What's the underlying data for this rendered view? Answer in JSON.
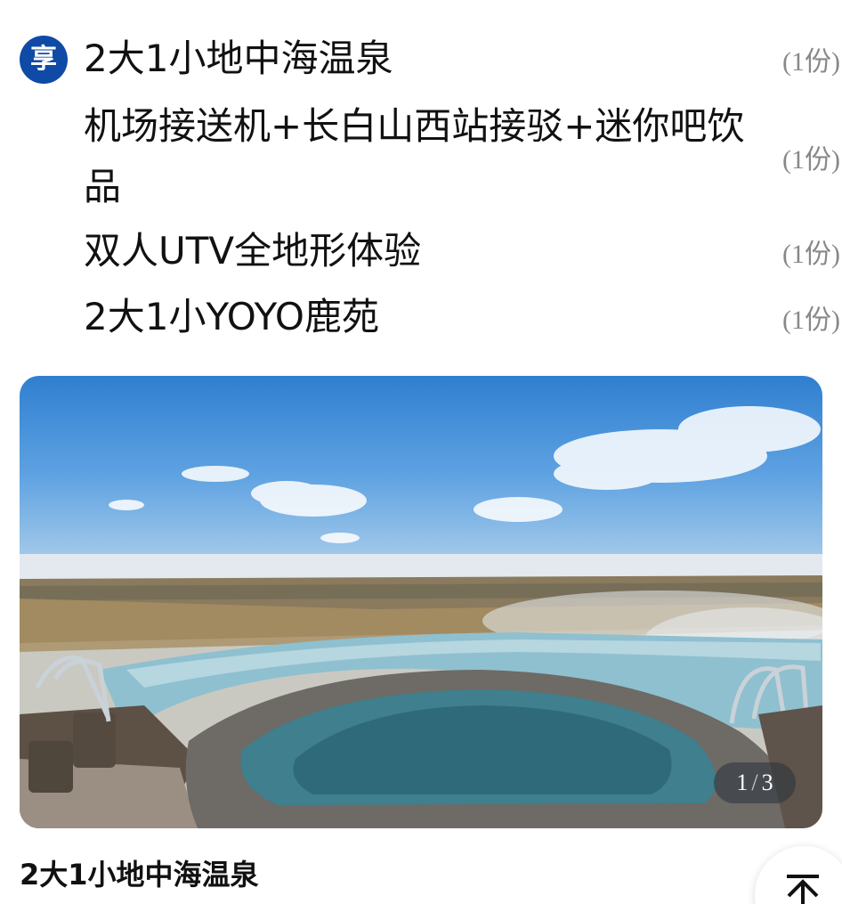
{
  "package": {
    "badge": "享",
    "items": [
      {
        "name": "2大1小地中海温泉",
        "qty": "(1份)"
      },
      {
        "name": "机场接送机+长白山西站接驳+迷你吧饮品",
        "qty": "(1份)"
      },
      {
        "name": "双人UTV全地形体验",
        "qty": "(1份)"
      },
      {
        "name": "2大1小YOYO鹿苑",
        "qty": "(1份)"
      }
    ]
  },
  "gallery": {
    "counter_current": "1",
    "counter_separator": "/",
    "counter_total": "3",
    "caption": "2大1小地中海温泉"
  },
  "icons": {
    "back_to_top": "arrow-up-icon"
  },
  "colors": {
    "badge": "#0f4aa6",
    "qty_text": "#888888"
  }
}
